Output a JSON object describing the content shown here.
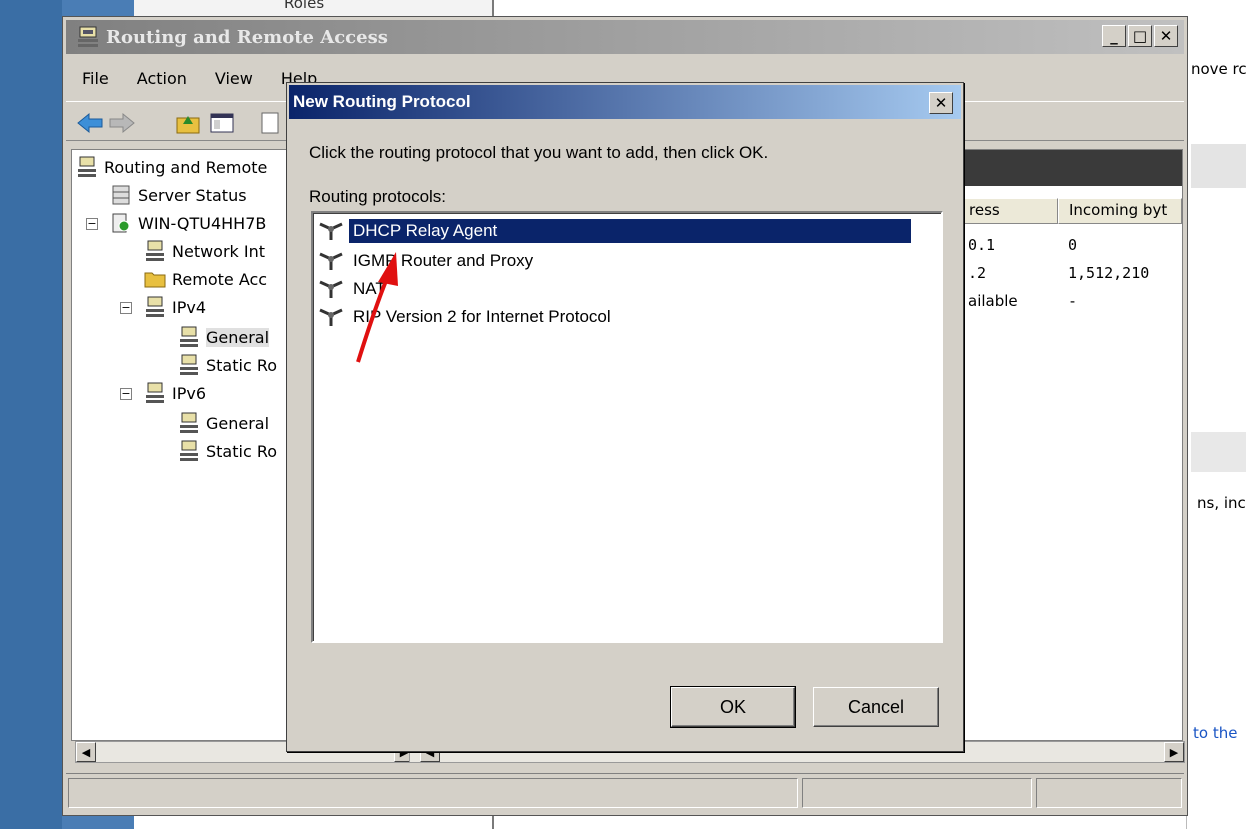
{
  "background": {
    "roles_label": "Roles",
    "right_text_1": "nove rc",
    "right_text_2": "ns, inc",
    "right_text_3": "to the"
  },
  "window": {
    "title": "Routing and Remote Access",
    "buttons": {
      "minimize": "_",
      "maximize": "□",
      "close": "✕"
    }
  },
  "menu": {
    "file": "File",
    "action": "Action",
    "view": "View",
    "help": "Help"
  },
  "tree": {
    "root": "Routing and Remote",
    "server_status": "Server Status",
    "server": "WIN-QTU4HH7B",
    "network_int": "Network Int",
    "remote_acc": "Remote Acc",
    "ipv4": "IPv4",
    "ipv4_general": "General",
    "ipv4_static": "Static Ro",
    "ipv6": "IPv6",
    "ipv6_general": "General",
    "ipv6_static": "Static Ro"
  },
  "details": {
    "columns": [
      "ress",
      "Incoming byt"
    ],
    "rows": [
      [
        "0.1",
        "0"
      ],
      [
        ".2",
        "1,512,210"
      ],
      [
        "ailable",
        "-"
      ]
    ]
  },
  "dialog": {
    "title": "New Routing Protocol",
    "instruction": "Click the routing protocol that you want to add, then click OK.",
    "list_label": "Routing protocols:",
    "protocols": [
      "DHCP Relay Agent",
      "IGMP Router and Proxy",
      "NAT",
      "RIP Version 2 for Internet Protocol"
    ],
    "selected_index": 0,
    "ok_label": "OK",
    "cancel_label": "Cancel"
  },
  "colors": {
    "dialog_title_start": "#0a246a",
    "dialog_title_end": "#a6caf0",
    "selection": "#0a246a",
    "arrow": "#e01010"
  }
}
